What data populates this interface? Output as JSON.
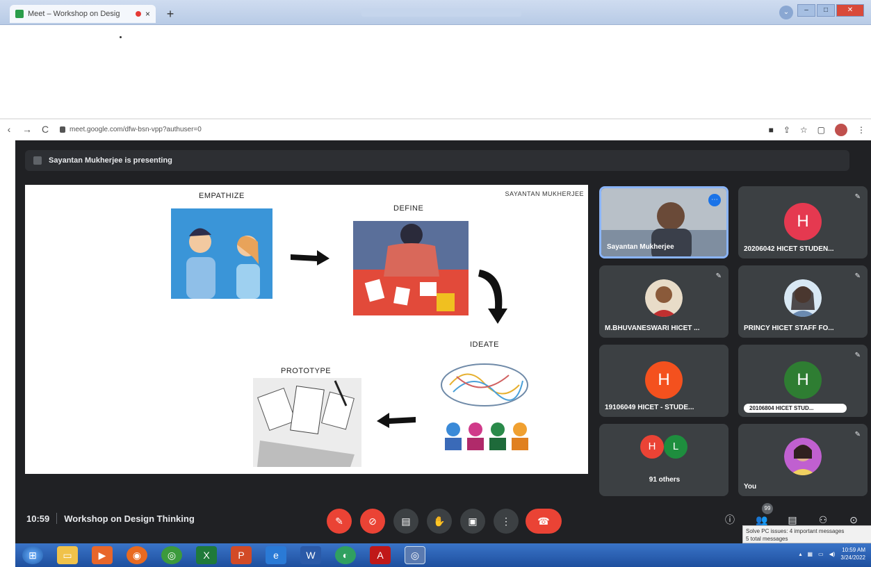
{
  "browser": {
    "tab_title": "Meet – Workshop on Desig",
    "tab_close": "×",
    "new_tab": "+",
    "back": "‹",
    "forward": "→",
    "reload": "C",
    "url": "meet.google.com/dfw-bsn-vpp?authuser=0"
  },
  "meet": {
    "presenting_banner": "Sayantan Mukherjee is presenting",
    "slide": {
      "author": "SAYANTAN MUKHERJEE",
      "empathize": "EMPATHIZE",
      "define": "DEFINE",
      "ideate": "IDEATE",
      "prototype": "PROTOTYPE"
    },
    "tiles": [
      {
        "name": "Sayantan Mukherjee"
      },
      {
        "name": "20206042 HICET STUDEN...",
        "initial": "H",
        "color": "#e53950"
      },
      {
        "name": "M.BHUVANESWARI HICET ..."
      },
      {
        "name": "PRINCY HICET STAFF FO..."
      },
      {
        "name": "19106049 HICET - STUDE...",
        "initial": "H",
        "color": "#f4511e"
      },
      {
        "name": "20106804 HICET STUD...",
        "initial": "H",
        "color": "#2e7d32"
      },
      {
        "name": "91 others",
        "initial1": "H",
        "initial2": "L"
      },
      {
        "name": "You"
      }
    ],
    "time": "10:59",
    "meeting_title": "Workshop on Design Thinking",
    "participants_count": "99",
    "tooltip_line1": "Solve PC issues: 4 important messages",
    "tooltip_line2": "5 total messages"
  },
  "taskbar": {
    "clock_time": "10:59 AM",
    "clock_date": "3/24/2022"
  },
  "colors": {
    "meet_bg": "#202124",
    "tile_bg": "#3c4043",
    "red_button": "#ea4335",
    "accent": "#8ab4f8"
  }
}
